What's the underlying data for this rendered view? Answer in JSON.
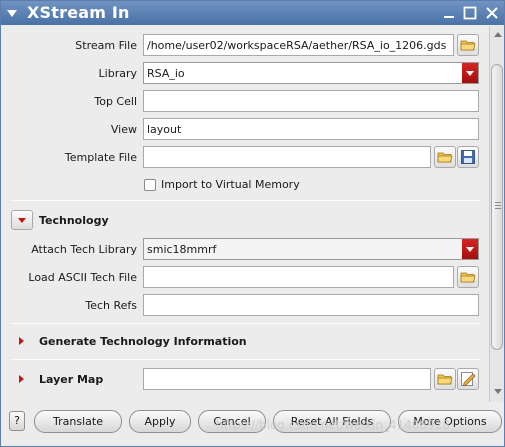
{
  "window": {
    "title": "XStream In",
    "colors": {
      "titlebar": "#5a80b3",
      "accent_red": "#c01515"
    }
  },
  "form": {
    "stream_file": {
      "label": "Stream File",
      "value": "/home/user02/workspaceRSA/aether/RSA_io_1206.gds"
    },
    "library": {
      "label": "Library",
      "value": "RSA_io"
    },
    "top_cell": {
      "label": "Top Cell",
      "value": ""
    },
    "view": {
      "label": "View",
      "value": "layout"
    },
    "template_file": {
      "label": "Template File",
      "value": ""
    },
    "import_virtual_memory": {
      "label": "Import to Virtual Memory",
      "checked": false
    }
  },
  "technology": {
    "title": "Technology",
    "expanded": true,
    "attach_tech_library": {
      "label": "Attach Tech Library",
      "value": "smic18mmrf"
    },
    "load_ascii_tech_file": {
      "label": "Load ASCII Tech File",
      "value": ""
    },
    "tech_refs": {
      "label": "Tech Refs",
      "value": ""
    }
  },
  "generate_tech_info": {
    "title": "Generate Technology Information",
    "expanded": false
  },
  "layer_map": {
    "title": "Layer Map",
    "value": "",
    "expanded": false
  },
  "buttons": {
    "help": "?",
    "translate": "Translate",
    "apply": "Apply",
    "cancel": "Cancel",
    "reset": "Reset All Fields",
    "more": "More Options"
  },
  "watermark": "https://blog.csdn.net/weixin_41408928",
  "icons": [
    "menu-icon",
    "minimize-icon",
    "maximize-icon",
    "close-icon",
    "folder-icon",
    "save-icon",
    "edit-icon",
    "chevron-down-icon",
    "chevron-right-icon"
  ]
}
